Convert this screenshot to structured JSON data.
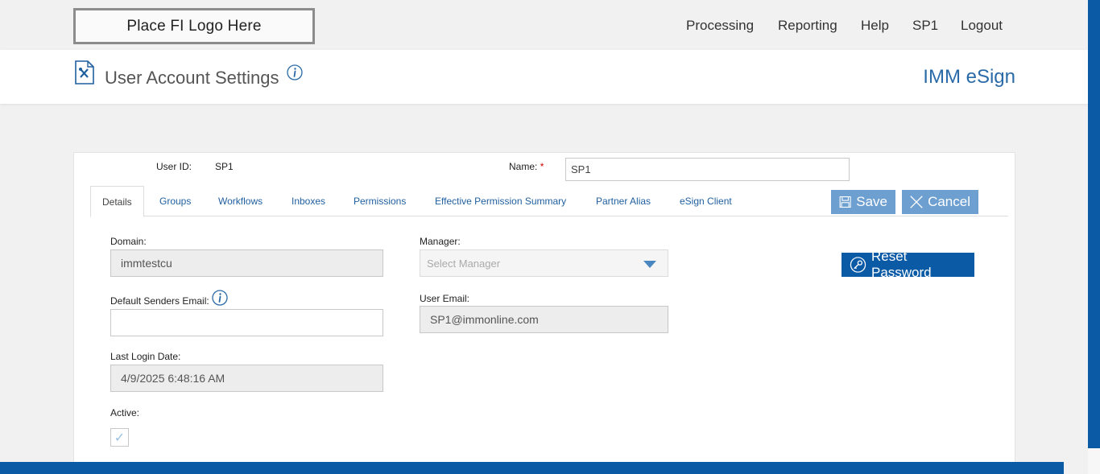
{
  "header": {
    "logo_text": "Place FI Logo Here",
    "nav": [
      "Processing",
      "Reporting",
      "Help",
      "SP1",
      "Logout"
    ]
  },
  "title_bar": {
    "title": "User Account Settings",
    "brand": "IMM eSign"
  },
  "form": {
    "user_id_label": "User ID:",
    "user_id_value": "SP1",
    "name_label": "Name:",
    "name_required": "*",
    "name_value": "SP1",
    "tabs": [
      "Details",
      "Groups",
      "Workflows",
      "Inboxes",
      "Permissions",
      "Effective Permission Summary",
      "Partner Alias",
      "eSign Client"
    ],
    "active_tab": "Details",
    "save_label": "Save",
    "cancel_label": "Cancel",
    "reset_password_label": "Reset Password",
    "domain_label": "Domain:",
    "domain_value": "immtestcu",
    "manager_label": "Manager:",
    "manager_placeholder": "Select Manager",
    "default_senders_email_label": "Default Senders Email:",
    "default_senders_email_value": "",
    "user_email_label": "User Email:",
    "user_email_value": "SP1@immonline.com",
    "last_login_label": "Last Login Date:",
    "last_login_value": "4/9/2025 6:48:16 AM",
    "active_label": "Active:",
    "active_checked": true
  },
  "colors": {
    "brand_blue": "#0a5aa6",
    "button_light_blue": "#6d9fd0",
    "link_blue": "#1f5f9f"
  }
}
